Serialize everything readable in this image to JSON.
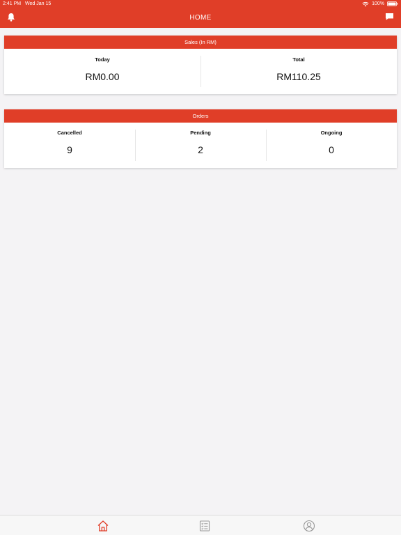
{
  "status_bar": {
    "time": "2:41 PM",
    "date": "Wed Jan 15",
    "battery": "100%"
  },
  "nav": {
    "title": "HOME",
    "left_icon": "bell-icon",
    "right_icon": "message-icon"
  },
  "sales": {
    "title": "Sales (In RM)",
    "stats": [
      {
        "label": "Today",
        "value": "RM0.00"
      },
      {
        "label": "Total",
        "value": "RM110.25"
      }
    ]
  },
  "orders": {
    "title": "Orders",
    "stats": [
      {
        "label": "Cancelled",
        "value": "9"
      },
      {
        "label": "Pending",
        "value": "2"
      },
      {
        "label": "Ongoing",
        "value": "0"
      }
    ]
  },
  "tab_bar": {
    "tabs": [
      {
        "icon": "home-icon",
        "active": true
      },
      {
        "icon": "order-list-icon",
        "active": false
      },
      {
        "icon": "profile-icon",
        "active": false
      }
    ]
  },
  "colors": {
    "brand_red": "#e03e28",
    "background": "#f4f3f5",
    "active_tab": "#e03e28",
    "inactive_tab": "#9a9a9a"
  }
}
